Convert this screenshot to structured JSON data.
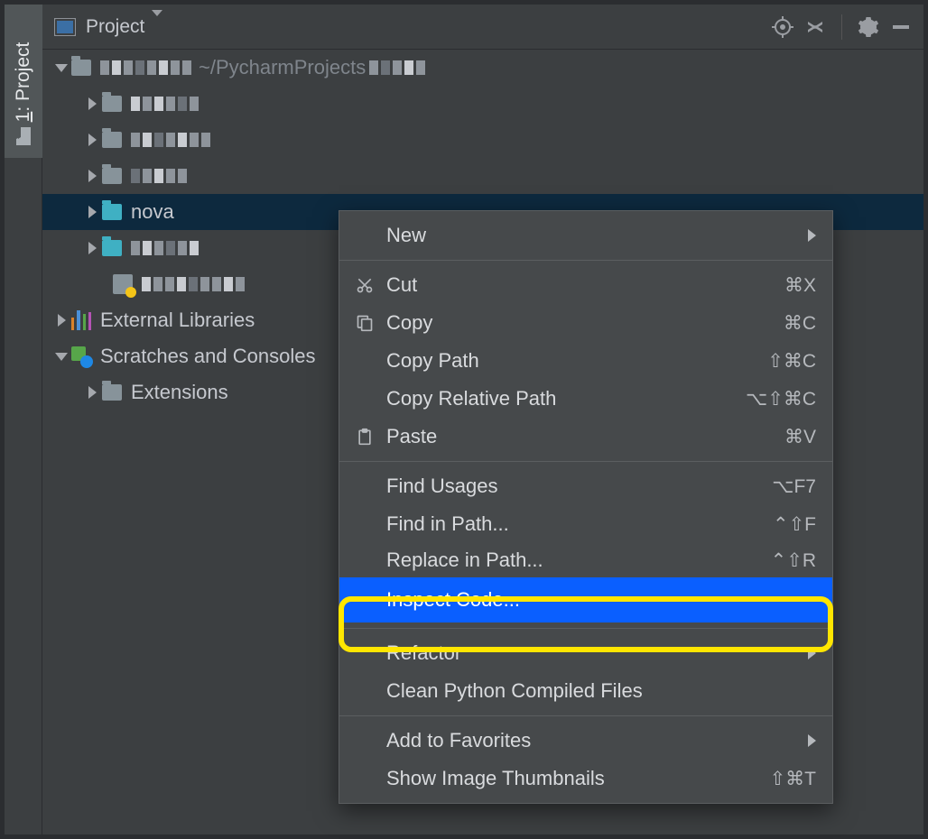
{
  "sidebar_tab": {
    "label": "1: Project"
  },
  "toolbar": {
    "view_label": "Project"
  },
  "tree": {
    "root_path_hint": "~/PycharmProjects",
    "selected": "nova",
    "ext_lib": "External Libraries",
    "scratches": "Scratches and Consoles",
    "extensions": "Extensions"
  },
  "context_menu": {
    "items": [
      {
        "label": "New",
        "submenu": true
      },
      {
        "sep": true
      },
      {
        "icon": "cut",
        "label": "Cut",
        "shortcut": "⌘X"
      },
      {
        "icon": "copy",
        "label": "Copy",
        "shortcut": "⌘C"
      },
      {
        "label": "Copy Path",
        "shortcut": "⇧⌘C"
      },
      {
        "label": "Copy Relative Path",
        "shortcut": "⌥⇧⌘C"
      },
      {
        "icon": "paste",
        "label": "Paste",
        "shortcut": "⌘V"
      },
      {
        "sep": true
      },
      {
        "label": "Find Usages",
        "shortcut": "⌥F7"
      },
      {
        "label": "Find in Path...",
        "shortcut": "⌃⇧F"
      },
      {
        "label": "Replace in Path...",
        "shortcut": "⌃⇧R"
      },
      {
        "label": "Inspect Code...",
        "highlight": true
      },
      {
        "sep": true
      },
      {
        "label": "Refactor",
        "submenu": true
      },
      {
        "label": "Clean Python Compiled Files"
      },
      {
        "sep": true
      },
      {
        "label": "Add to Favorites",
        "submenu": true
      },
      {
        "label": "Show Image Thumbnails",
        "shortcut": "⇧⌘T"
      }
    ]
  }
}
